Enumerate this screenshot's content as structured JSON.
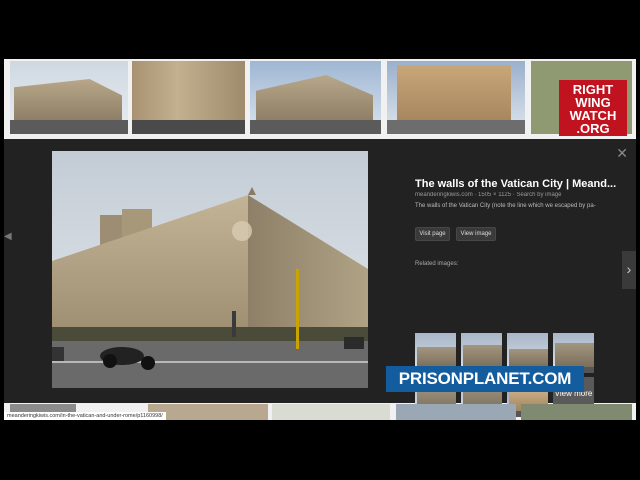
{
  "preview": {
    "title": "The walls of the Vatican City | Meand...",
    "meta": "meanderingkiwis.com · 1505 × 1125 · Search by image",
    "description": "The walls of the Vatican City (note the line which we escaped by pa-",
    "visit_page_label": "Visit page",
    "view_image_label": "View image",
    "related_label": "Related images:",
    "view_more_label": "View more",
    "close_icon": "close-icon",
    "next_icon": "chevron-right-icon"
  },
  "status_url": "meanderingkiwis.com/in-the-vatican-and-under-rome/p1160998/",
  "watermarks": {
    "right_wing_watch": [
      "RIGHT",
      "WING",
      "WATCH",
      ".ORG"
    ],
    "prison_planet": "PRISONPLANET.COM"
  },
  "colors": {
    "panel_bg": "#222222",
    "rww_red": "#c1121f",
    "pp_blue": "#135c9e"
  }
}
